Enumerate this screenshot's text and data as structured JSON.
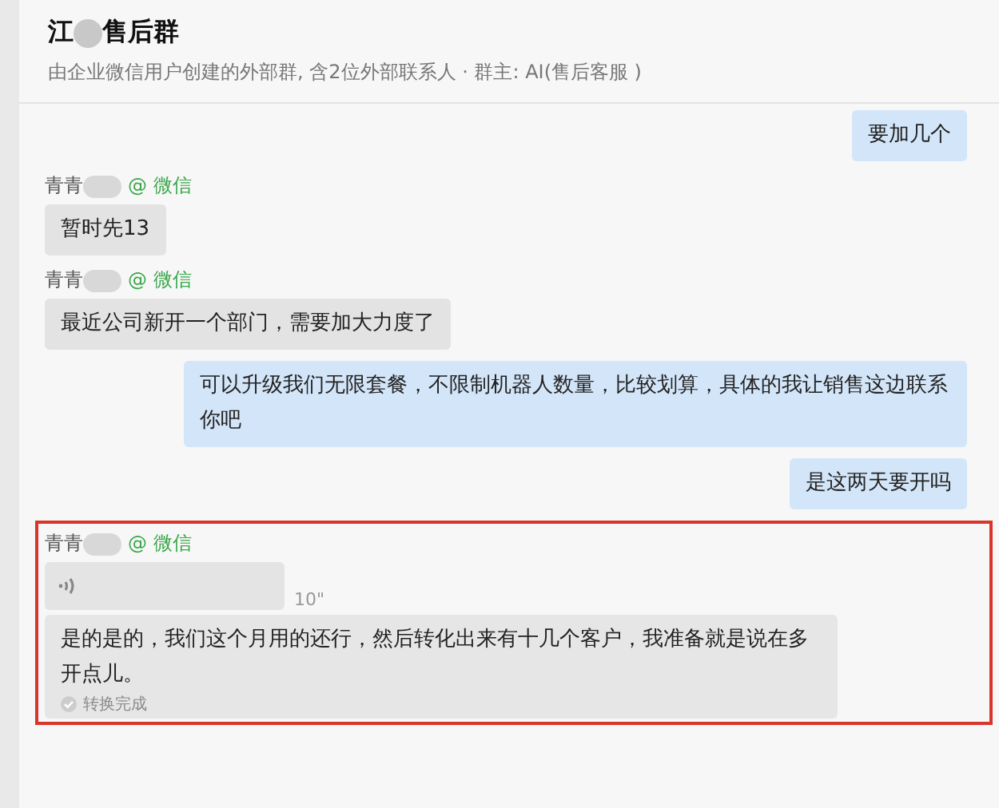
{
  "header": {
    "title_start": "江",
    "title_end": "售后群",
    "subtitle": "由企业微信用户创建的外部群, 含2位外部联系人 · 群主: AI(售后客服 )"
  },
  "messages": [
    {
      "outgoing": true,
      "kind": "text",
      "text": "要加几个",
      "highlighted": false
    },
    {
      "outgoing": false,
      "sender": "青青",
      "source": "@ 微信",
      "kind": "text",
      "text": "暂时先13",
      "highlighted": false
    },
    {
      "outgoing": false,
      "sender": "青青",
      "source": "@ 微信",
      "kind": "text",
      "text": "最近公司新开一个部门，需要加大力度了",
      "highlighted": false
    },
    {
      "outgoing": true,
      "kind": "text",
      "text": "可以升级我们无限套餐，不限制机器人数量，比较划算，具体的我让销售这边联系你吧",
      "highlighted": false
    },
    {
      "outgoing": true,
      "kind": "text",
      "text": "是这两天要开吗",
      "highlighted": false
    },
    {
      "outgoing": false,
      "sender": "青青",
      "source": "@ 微信",
      "kind": "voice",
      "duration": "10\"",
      "transcript": "是的是的，我们这个月用的还行，然后转化出来有十几个客户，我准备就是说在多开点儿。",
      "status": "转换完成",
      "highlighted": true
    }
  ]
}
